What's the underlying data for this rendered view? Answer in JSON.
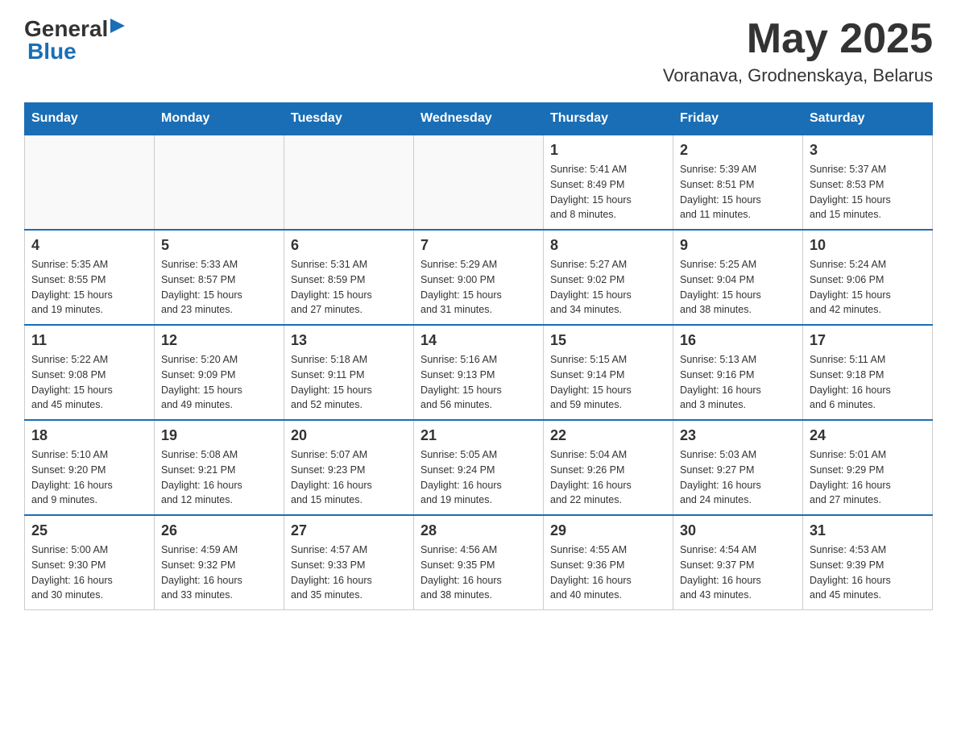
{
  "header": {
    "logo_general": "General",
    "logo_arrow": "▶",
    "logo_blue": "Blue",
    "month_year": "May 2025",
    "location": "Voranava, Grodnenskaya, Belarus"
  },
  "days_of_week": [
    "Sunday",
    "Monday",
    "Tuesday",
    "Wednesday",
    "Thursday",
    "Friday",
    "Saturday"
  ],
  "weeks": [
    [
      {
        "day": "",
        "info": ""
      },
      {
        "day": "",
        "info": ""
      },
      {
        "day": "",
        "info": ""
      },
      {
        "day": "",
        "info": ""
      },
      {
        "day": "1",
        "info": "Sunrise: 5:41 AM\nSunset: 8:49 PM\nDaylight: 15 hours\nand 8 minutes."
      },
      {
        "day": "2",
        "info": "Sunrise: 5:39 AM\nSunset: 8:51 PM\nDaylight: 15 hours\nand 11 minutes."
      },
      {
        "day": "3",
        "info": "Sunrise: 5:37 AM\nSunset: 8:53 PM\nDaylight: 15 hours\nand 15 minutes."
      }
    ],
    [
      {
        "day": "4",
        "info": "Sunrise: 5:35 AM\nSunset: 8:55 PM\nDaylight: 15 hours\nand 19 minutes."
      },
      {
        "day": "5",
        "info": "Sunrise: 5:33 AM\nSunset: 8:57 PM\nDaylight: 15 hours\nand 23 minutes."
      },
      {
        "day": "6",
        "info": "Sunrise: 5:31 AM\nSunset: 8:59 PM\nDaylight: 15 hours\nand 27 minutes."
      },
      {
        "day": "7",
        "info": "Sunrise: 5:29 AM\nSunset: 9:00 PM\nDaylight: 15 hours\nand 31 minutes."
      },
      {
        "day": "8",
        "info": "Sunrise: 5:27 AM\nSunset: 9:02 PM\nDaylight: 15 hours\nand 34 minutes."
      },
      {
        "day": "9",
        "info": "Sunrise: 5:25 AM\nSunset: 9:04 PM\nDaylight: 15 hours\nand 38 minutes."
      },
      {
        "day": "10",
        "info": "Sunrise: 5:24 AM\nSunset: 9:06 PM\nDaylight: 15 hours\nand 42 minutes."
      }
    ],
    [
      {
        "day": "11",
        "info": "Sunrise: 5:22 AM\nSunset: 9:08 PM\nDaylight: 15 hours\nand 45 minutes."
      },
      {
        "day": "12",
        "info": "Sunrise: 5:20 AM\nSunset: 9:09 PM\nDaylight: 15 hours\nand 49 minutes."
      },
      {
        "day": "13",
        "info": "Sunrise: 5:18 AM\nSunset: 9:11 PM\nDaylight: 15 hours\nand 52 minutes."
      },
      {
        "day": "14",
        "info": "Sunrise: 5:16 AM\nSunset: 9:13 PM\nDaylight: 15 hours\nand 56 minutes."
      },
      {
        "day": "15",
        "info": "Sunrise: 5:15 AM\nSunset: 9:14 PM\nDaylight: 15 hours\nand 59 minutes."
      },
      {
        "day": "16",
        "info": "Sunrise: 5:13 AM\nSunset: 9:16 PM\nDaylight: 16 hours\nand 3 minutes."
      },
      {
        "day": "17",
        "info": "Sunrise: 5:11 AM\nSunset: 9:18 PM\nDaylight: 16 hours\nand 6 minutes."
      }
    ],
    [
      {
        "day": "18",
        "info": "Sunrise: 5:10 AM\nSunset: 9:20 PM\nDaylight: 16 hours\nand 9 minutes."
      },
      {
        "day": "19",
        "info": "Sunrise: 5:08 AM\nSunset: 9:21 PM\nDaylight: 16 hours\nand 12 minutes."
      },
      {
        "day": "20",
        "info": "Sunrise: 5:07 AM\nSunset: 9:23 PM\nDaylight: 16 hours\nand 15 minutes."
      },
      {
        "day": "21",
        "info": "Sunrise: 5:05 AM\nSunset: 9:24 PM\nDaylight: 16 hours\nand 19 minutes."
      },
      {
        "day": "22",
        "info": "Sunrise: 5:04 AM\nSunset: 9:26 PM\nDaylight: 16 hours\nand 22 minutes."
      },
      {
        "day": "23",
        "info": "Sunrise: 5:03 AM\nSunset: 9:27 PM\nDaylight: 16 hours\nand 24 minutes."
      },
      {
        "day": "24",
        "info": "Sunrise: 5:01 AM\nSunset: 9:29 PM\nDaylight: 16 hours\nand 27 minutes."
      }
    ],
    [
      {
        "day": "25",
        "info": "Sunrise: 5:00 AM\nSunset: 9:30 PM\nDaylight: 16 hours\nand 30 minutes."
      },
      {
        "day": "26",
        "info": "Sunrise: 4:59 AM\nSunset: 9:32 PM\nDaylight: 16 hours\nand 33 minutes."
      },
      {
        "day": "27",
        "info": "Sunrise: 4:57 AM\nSunset: 9:33 PM\nDaylight: 16 hours\nand 35 minutes."
      },
      {
        "day": "28",
        "info": "Sunrise: 4:56 AM\nSunset: 9:35 PM\nDaylight: 16 hours\nand 38 minutes."
      },
      {
        "day": "29",
        "info": "Sunrise: 4:55 AM\nSunset: 9:36 PM\nDaylight: 16 hours\nand 40 minutes."
      },
      {
        "day": "30",
        "info": "Sunrise: 4:54 AM\nSunset: 9:37 PM\nDaylight: 16 hours\nand 43 minutes."
      },
      {
        "day": "31",
        "info": "Sunrise: 4:53 AM\nSunset: 9:39 PM\nDaylight: 16 hours\nand 45 minutes."
      }
    ]
  ]
}
